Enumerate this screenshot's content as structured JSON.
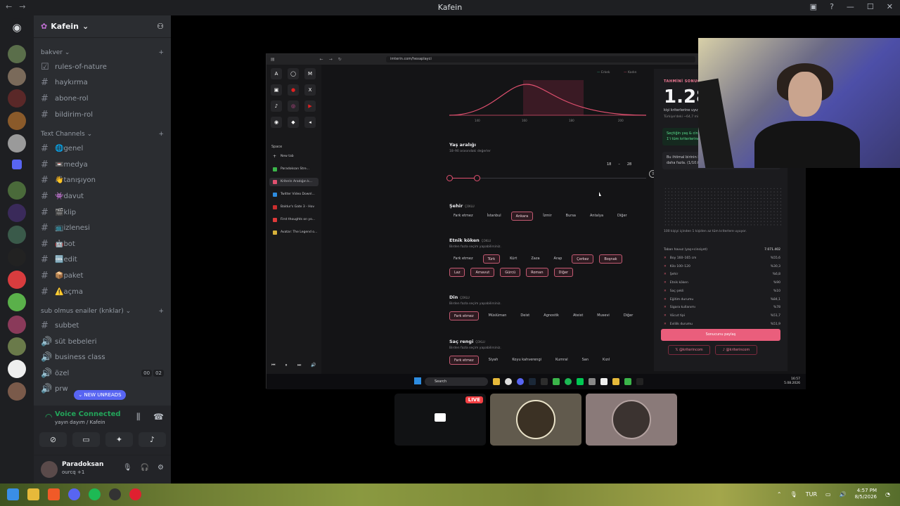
{
  "window": {
    "title": "Kafein"
  },
  "server": {
    "name": "Kafein"
  },
  "categories": [
    {
      "name": "bakver",
      "channels": [
        {
          "name": "rules-of-nature",
          "icon": "rules-icon"
        },
        {
          "name": "haykırma",
          "icon": "hash-icon"
        },
        {
          "name": "abone-rol",
          "icon": "hash-icon"
        },
        {
          "name": "bildirim-rol",
          "icon": "hash-icon"
        }
      ]
    },
    {
      "name": "Text Channels",
      "channels": [
        {
          "name": "🌐genel",
          "icon": "hash-icon"
        },
        {
          "name": "📼medya",
          "icon": "hash-icon"
        },
        {
          "name": "👋tanışıyon",
          "icon": "hash-icon"
        },
        {
          "name": "👾davut",
          "icon": "hash-icon"
        },
        {
          "name": "🎬klip",
          "icon": "hash-icon"
        },
        {
          "name": "📺izlenesi",
          "icon": "hash-icon"
        },
        {
          "name": "🤖bot",
          "icon": "hash-icon"
        },
        {
          "name": "🆒edit",
          "icon": "hash-icon"
        },
        {
          "name": "📦paket",
          "icon": "hash-icon"
        },
        {
          "name": "⚠️açma",
          "icon": "hash-icon"
        }
      ]
    },
    {
      "name": "sub olmus enailer (knklar)",
      "channels": [
        {
          "name": "subbet",
          "icon": "hash-icon"
        },
        {
          "name": "süt bebeleri",
          "icon": "speaker-icon"
        },
        {
          "name": "business class",
          "icon": "speaker-icon"
        },
        {
          "name": "özel",
          "icon": "speaker-icon",
          "badges": [
            "00",
            "02"
          ]
        },
        {
          "name": "prw",
          "icon": "speaker-icon"
        }
      ]
    }
  ],
  "new_unreads": "NEW UNREADS",
  "voice": {
    "title": "Voice Connected",
    "subtitle": "yayın dayım / Kafein"
  },
  "user": {
    "name": "Paradoksan",
    "status": "ourcq +1"
  },
  "browser": {
    "url": "imterin.com/hexaplayci",
    "space": "Space",
    "new_tab": "New tab",
    "tabs": [
      {
        "label": "Paradoksan Stre...",
        "color": "#3bb54a",
        "active": false
      },
      {
        "label": "Kriterin  Aradığın k...",
        "color": "#e0506f",
        "active": true
      },
      {
        "label": "Twitter Video Downl...",
        "color": "#2d8ce0",
        "active": false
      },
      {
        "label": "Baldur's Gate 3 - Hov",
        "color": "#cc2e2e",
        "active": false
      },
      {
        "label": "First thoughts on yo...",
        "color": "#e03a3a",
        "active": false
      },
      {
        "label": "Avatar: The Legend o...",
        "color": "#d6b13a",
        "active": false
      }
    ],
    "chart_legend": [
      "Erkek",
      "Kadın"
    ],
    "chart_ticks": [
      "140",
      "160",
      "180",
      "200"
    ],
    "age": {
      "title": "Yaş aralığı",
      "sub": "18–90 arasındaki değerler",
      "min": "18",
      "sep": "–",
      "max": "28",
      "fraction": 0.14
    },
    "city": {
      "title": "Şehir",
      "tag": "ÇOKLU",
      "options": [
        "Fark etmez",
        "İstanbul",
        "Ankara",
        "İzmir",
        "Bursa",
        "Antalya",
        "Diğer"
      ],
      "selected": "Ankara"
    },
    "ethnic": {
      "title": "Etnik köken",
      "tag": "ÇOKLU",
      "sub": "Birden fazla seçim yapabilirsiniz.",
      "options": [
        "Fark etmez",
        "Türk",
        "Kürt",
        "Zaza",
        "Arap",
        "Çerkez",
        "Boşnak",
        "Laz",
        "Arnavut",
        "Gürcü",
        "Roman",
        "Diğer"
      ],
      "selected": [
        "Türk",
        "Çerkez",
        "Boşnak",
        "Laz",
        "Arnavut",
        "Gürcü",
        "Roman",
        "Diğer"
      ]
    },
    "religion": {
      "title": "Din",
      "tag": "ÇOKLU",
      "sub": "Birden fazla seçim yapabilirsiniz.",
      "options": [
        "Fark etmez",
        "Müslüman",
        "Deist",
        "Agnostik",
        "Ateist",
        "Musevi",
        "Diğer"
      ],
      "selected": [
        "Fark etmez"
      ]
    },
    "hair": {
      "title": "Saç rengi",
      "tag": "ÇOKLU",
      "sub": "Birden fazla seçim yapabilirsiniz.",
      "options": [
        "Fark etmez",
        "Siyah",
        "Koyu kahverengi",
        "Kumral",
        "San",
        "Kızıl"
      ],
      "selected": [
        "Fark etmez"
      ]
    },
    "result": {
      "label": "TAHMİNİ SONUÇ",
      "value": "1.285",
      "line1": "kişi kriterlerine uyuyor (≈ 1.285)",
      "line2": "Türkiye'deki ~64,7 milyon yetişkinin %0,002'si",
      "green": "Seçtiğin yaş & cinsiyet havuzunun %0,0182'si · 5.502 kişiden 1'i tüm kriterlerine uyuyor.",
      "dark": "Bu ihtimal birinin kalbinin sağ tarafta olma ihtimalinden biraz daha fazla. (1/10.000)",
      "dots_caption": "100 kişiyi içinden 1 kişiden az tüm kriterlere uyuyor.",
      "base_label": "Taban havuz (yaş+cinsiyet)",
      "base_value": "7.071.402",
      "criteria": [
        {
          "label": "Boy 160–165 cm",
          "value": "%55,6"
        },
        {
          "label": "Kilo 100–120",
          "value": "%30,3"
        },
        {
          "label": "Şehir",
          "value": "%6,8"
        },
        {
          "label": "Etnik köken",
          "value": "%90"
        },
        {
          "label": "Saç şekli",
          "value": "%10"
        },
        {
          "label": "Eğitim durumu",
          "value": "%84,1"
        },
        {
          "label": "Sigara kullanımı",
          "value": "%78"
        },
        {
          "label": "Vücut tipi",
          "value": "%51,7"
        },
        {
          "label": "Evlilik durumu",
          "value": "%51,9"
        }
      ],
      "share": "Sonucunu paylaş",
      "social": [
        "@kriterincom",
        "@kriterincom"
      ]
    },
    "taskbar": {
      "search": "Search",
      "time": "16:57",
      "date": "5.08.2026"
    }
  },
  "tiles": {
    "live": "LIVE"
  },
  "system": {
    "lang": "TUR",
    "time": "4:57 PM",
    "date": "8/5/2026"
  }
}
